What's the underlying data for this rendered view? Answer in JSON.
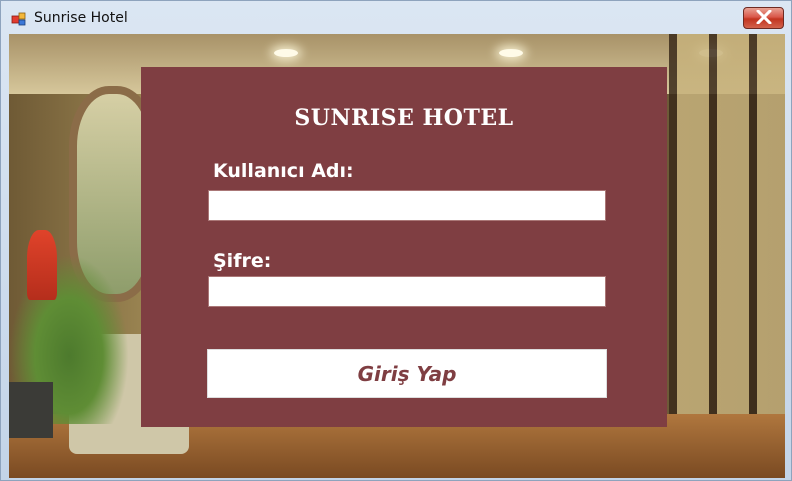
{
  "window": {
    "title": "Sunrise Hotel",
    "close_icon": "close-x-icon",
    "app_icon": "app-window-icon"
  },
  "login": {
    "heading": "SUNRISE HOTEL",
    "username_label": "Kullanıcı Adı:",
    "username_value": "",
    "password_label": "Şifre:",
    "password_value": "",
    "submit_label": "Giriş Yap"
  },
  "colors": {
    "panel": "#7f3e42",
    "button_text": "#7f3e42",
    "close_button": "#c23420"
  }
}
